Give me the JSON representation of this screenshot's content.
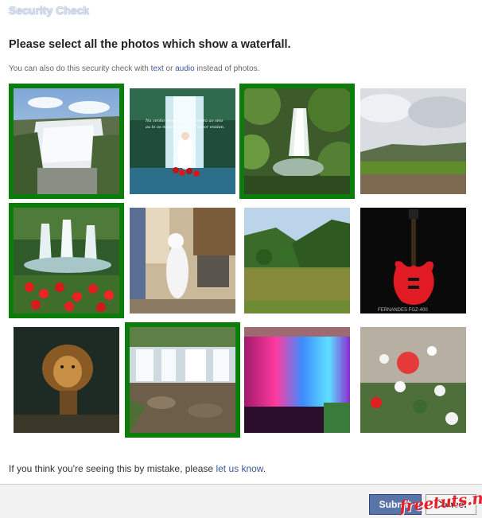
{
  "dialog": {
    "title": "Security Check",
    "heading": "Please select all the photos which show a waterfall.",
    "alt_prefix": "You can also do this security check with ",
    "alt_text_link": "text",
    "alt_mid": " or ",
    "alt_audio_link": "audio",
    "alt_suffix": " instead of photos."
  },
  "photos": [
    {
      "subject": "waterfall canyon",
      "selected": true
    },
    {
      "subject": "waterfall with bride artwork",
      "selected": false
    },
    {
      "subject": "forest waterfall",
      "selected": true
    },
    {
      "subject": "grass field under cloudy sky",
      "selected": false
    },
    {
      "subject": "fountain with red flowers",
      "selected": true
    },
    {
      "subject": "cat in kitchen",
      "selected": false
    },
    {
      "subject": "lake with green hills",
      "selected": false
    },
    {
      "subject": "red electric guitar",
      "selected": false
    },
    {
      "subject": "lion",
      "selected": false
    },
    {
      "subject": "tiered waterfall",
      "selected": true
    },
    {
      "subject": "colorfully lit waterfall",
      "selected": false
    },
    {
      "subject": "flowers",
      "selected": false
    }
  ],
  "artwork_text": {
    "overlay_line_1": "Na cenho tenho que o fizibeira ao seio",
    "overlay_line_2": "au le os minses raihar, of sabor enidan.",
    "guitar_label": "FERNANDES FGZ-400"
  },
  "footer": {
    "mistake_prefix": "If you think you're seeing this by mistake, please ",
    "mistake_link": "let us know",
    "mistake_suffix": ".",
    "submit_label": "Submit",
    "cancel_label": "Cancel"
  },
  "watermark": "freetuts.net",
  "colors": {
    "selected_border": "#0a7d0a",
    "link": "#3b5998",
    "submit_bg": "#5b74a8"
  }
}
